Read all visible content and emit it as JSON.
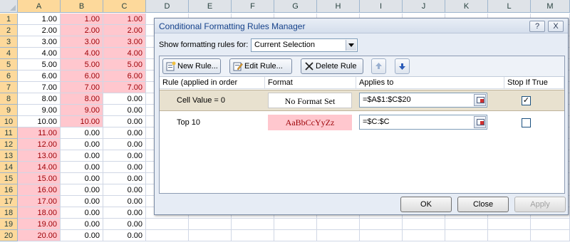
{
  "sheet": {
    "columns": [
      "A",
      "B",
      "C",
      "D",
      "E",
      "F",
      "G",
      "H",
      "I",
      "J",
      "K",
      "L",
      "M"
    ],
    "rows": [
      {
        "n": "1",
        "a": "1.00",
        "b": "1.00",
        "c": "1.00"
      },
      {
        "n": "2",
        "a": "2.00",
        "b": "2.00",
        "c": "2.00"
      },
      {
        "n": "3",
        "a": "3.00",
        "b": "3.00",
        "c": "3.00"
      },
      {
        "n": "4",
        "a": "4.00",
        "b": "4.00",
        "c": "4.00"
      },
      {
        "n": "5",
        "a": "5.00",
        "b": "5.00",
        "c": "5.00"
      },
      {
        "n": "6",
        "a": "6.00",
        "b": "6.00",
        "c": "6.00"
      },
      {
        "n": "7",
        "a": "7.00",
        "b": "7.00",
        "c": "7.00"
      },
      {
        "n": "8",
        "a": "8.00",
        "b": "8.00",
        "c": "0.00"
      },
      {
        "n": "9",
        "a": "9.00",
        "b": "9.00",
        "c": "0.00"
      },
      {
        "n": "10",
        "a": "10.00",
        "b": "10.00",
        "c": "0.00"
      },
      {
        "n": "11",
        "a": "11.00",
        "b": "0.00",
        "c": "0.00"
      },
      {
        "n": "12",
        "a": "12.00",
        "b": "0.00",
        "c": "0.00"
      },
      {
        "n": "13",
        "a": "13.00",
        "b": "0.00",
        "c": "0.00"
      },
      {
        "n": "14",
        "a": "14.00",
        "b": "0.00",
        "c": "0.00"
      },
      {
        "n": "15",
        "a": "15.00",
        "b": "0.00",
        "c": "0.00"
      },
      {
        "n": "16",
        "a": "16.00",
        "b": "0.00",
        "c": "0.00"
      },
      {
        "n": "17",
        "a": "17.00",
        "b": "0.00",
        "c": "0.00"
      },
      {
        "n": "18",
        "a": "18.00",
        "b": "0.00",
        "c": "0.00"
      },
      {
        "n": "19",
        "a": "19.00",
        "b": "0.00",
        "c": "0.00"
      },
      {
        "n": "20",
        "a": "20.00",
        "b": "0.00",
        "c": "0.00"
      }
    ],
    "highlight_color": "#ffc7ce",
    "highlight_text_color": "#9c0006"
  },
  "dialog": {
    "title": "Conditional Formatting Rules Manager",
    "help_button": "?",
    "close_button": "X",
    "show_label": "Show formatting rules for:",
    "show_value": "Current Selection",
    "new_rule": "New Rule...",
    "edit_rule": "Edit Rule...",
    "delete_rule": "Delete Rule",
    "headers": {
      "rule": "Rule (applied in order shown)",
      "format": "Format",
      "applies": "Applies to",
      "stop": "Stop If True"
    },
    "rules": [
      {
        "name": "Cell Value = 0",
        "format": "No Format Set",
        "applies": "=$A$1:$C$20",
        "stop": "✓"
      },
      {
        "name": "Top 10",
        "format": "AaBbCcYyZz",
        "applies": "=$C:$C",
        "stop": ""
      }
    ],
    "ok": "OK",
    "close": "Close",
    "apply": "Apply"
  }
}
